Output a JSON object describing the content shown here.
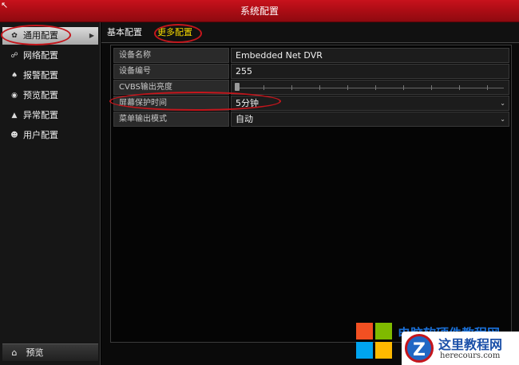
{
  "window": {
    "title": "系统配置"
  },
  "sidebar": {
    "items": [
      {
        "label": "通用配置",
        "icon": "gear-icon",
        "glyph": "✿",
        "active": true
      },
      {
        "label": "网络配置",
        "icon": "network-icon",
        "glyph": "☍",
        "active": false
      },
      {
        "label": "报警配置",
        "icon": "alarm-icon",
        "glyph": "♠",
        "active": false
      },
      {
        "label": "预览配置",
        "icon": "eye-icon",
        "glyph": "◉",
        "active": false
      },
      {
        "label": "异常配置",
        "icon": "warning-icon",
        "glyph": "▲",
        "active": false
      },
      {
        "label": "用户配置",
        "icon": "users-icon",
        "glyph": "☻",
        "active": false
      }
    ],
    "bottom": {
      "label": "预览",
      "icon": "home-icon",
      "glyph": "⌂"
    }
  },
  "tabs": [
    {
      "label": "基本配置",
      "active": false
    },
    {
      "label": "更多配置",
      "active": true
    }
  ],
  "settings": {
    "device_name": {
      "label": "设备名称",
      "value": "Embedded Net DVR"
    },
    "device_number": {
      "label": "设备编号",
      "value": "255"
    },
    "cvbs_brightness": {
      "label": "CVBS输出亮度",
      "value": ""
    },
    "screensaver_time": {
      "label": "屏幕保护时间",
      "value": "5分钟"
    },
    "menu_output_mode": {
      "label": "菜单输出模式",
      "value": "自动"
    }
  },
  "watermark": {
    "line1": "电脑软硬件教程网",
    "badge_title": "这里教程网",
    "badge_url": "herecours.com",
    "badge_glyph": "Z"
  },
  "colors": {
    "title_bar": "#b3101a",
    "active_tab": "#f6d900",
    "annotation_ring": "#c4161c"
  }
}
